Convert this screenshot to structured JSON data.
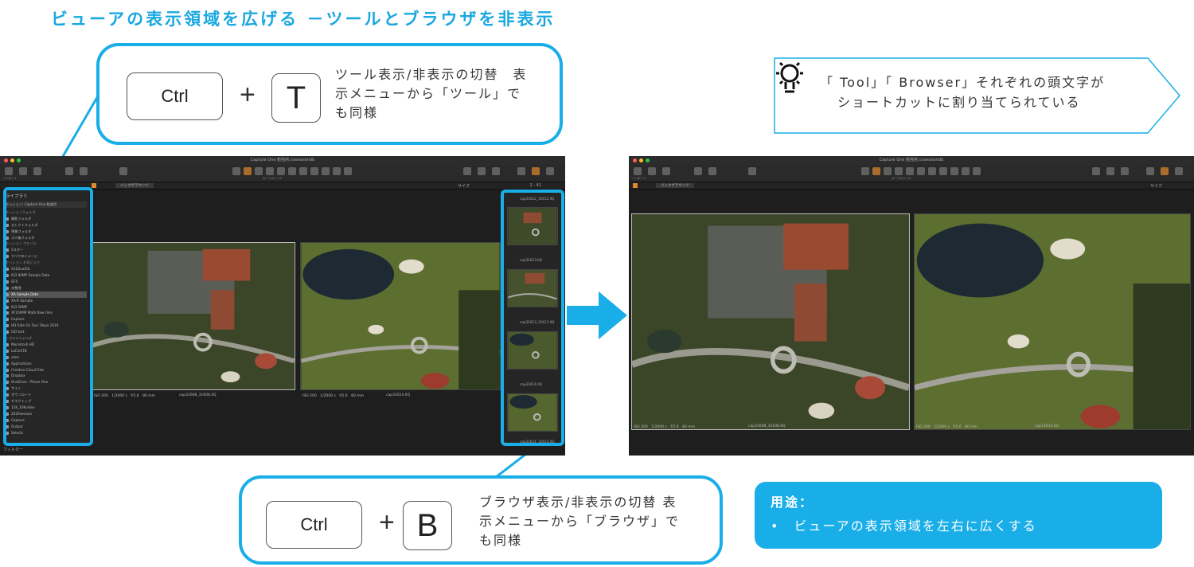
{
  "page": {
    "title": "ビューアの表示領域を広げる －ツールとブラウザを非表示"
  },
  "shortcut_tools": {
    "modifier": "Ctrl",
    "plus": "+",
    "key": "T",
    "desc_line1": "ツール表示/非表示の切替　表",
    "desc_line2": "示メニューから「ツール」で",
    "desc_line3": "も同様"
  },
  "shortcut_browser": {
    "modifier": "Ctrl",
    "plus": "+",
    "key": "B",
    "desc_line1": "ブラウザ表示/非表示の切替 表",
    "desc_line2": "示メニューから「ブラウザ」で",
    "desc_line3": "も同様"
  },
  "tip": {
    "icon": "lightbulb-icon",
    "line1": "「 Tool」「 Browser」それぞれの頭文字が",
    "line2": "ショートカットに割り当てられている"
  },
  "use": {
    "title": "用途：",
    "item": "•　ビューアの表示領域を左右に広くする"
  },
  "app": {
    "window_title": "Capture One 勉強用.cosessiondb",
    "toolbar_left": [
      "インポート",
      "エクスポート",
      "撮影"
    ],
    "toolbar_undo": [
      "リセット",
      "取り消す/やり直す"
    ],
    "toolbar_auto": "オート調整",
    "toolbar_cursor": "カーソルツール",
    "toolbar_right": [
      "ビフォー",
      "グリッド",
      "露出警告",
      "予定",
      "選択項目を編集",
      "コピー/適用"
    ],
    "background_select": "バックグラウンド",
    "size_label": "サイズ",
    "count": "2 - 41",
    "library": {
      "title": "ライブラリ",
      "session_select": "セッション: Capture One 勉強用",
      "rows": [
        {
          "label": "セッションフォルダ",
          "type": "hd"
        },
        {
          "label": "撮影フォルダ",
          "type": "item"
        },
        {
          "label": "セレクトフォルダ",
          "type": "item"
        },
        {
          "label": "現像フォルダ",
          "type": "item"
        },
        {
          "label": "ゴミ箱フォルダ",
          "type": "item"
        },
        {
          "label": "セッション アルバム",
          "type": "hd"
        },
        {
          "label": "5スター",
          "type": "item"
        },
        {
          "label": "すべてのイメージ",
          "type": "item"
        },
        {
          "label": "セッション お気に入り",
          "type": "hd"
        },
        {
          "label": "X1D2ux50c",
          "type": "item"
        },
        {
          "label": "IQ3 80MP Sample Data",
          "type": "item"
        },
        {
          "label": "GFX",
          "type": "item"
        },
        {
          "label": "未整理",
          "type": "item"
        },
        {
          "label": "XA Sample Data",
          "type": "sel"
        },
        {
          "label": "XA-R Sample",
          "type": "item"
        },
        {
          "label": "IQ3 50MP",
          "type": "item"
        },
        {
          "label": "XF100MP Math Raw Files",
          "type": "item"
        },
        {
          "label": "Capture",
          "type": "item"
        },
        {
          "label": "HD Ride On Tour Tokyo 2019",
          "type": "item"
        },
        {
          "label": "ISO test",
          "type": "item"
        },
        {
          "label": "システムフォルダ",
          "type": "hd"
        },
        {
          "label": "Macintosh HD",
          "type": "item"
        },
        {
          "label": "LaCie1TB",
          "type": "item"
        },
        {
          "label": "alien",
          "type": "item"
        },
        {
          "label": "Applications",
          "type": "item"
        },
        {
          "label": "Creative Cloud Files",
          "type": "item"
        },
        {
          "label": "Dropbox",
          "type": "item"
        },
        {
          "label": "OneDrive - Phase One",
          "type": "item"
        },
        {
          "label": "サイト",
          "type": "item"
        },
        {
          "label": "ダウンロード",
          "type": "item"
        },
        {
          "label": "デスクトップ",
          "type": "item"
        },
        {
          "label": "12K_10Kvideo",
          "type": "item"
        },
        {
          "label": "2020session",
          "type": "item"
        },
        {
          "label": "Capture",
          "type": "item"
        },
        {
          "label": "Output",
          "type": "item"
        },
        {
          "label": "Selects",
          "type": "item"
        }
      ],
      "filter_label": "フィルター"
    },
    "viewer_images": [
      {
        "meta": "ISO 200　1/2000 s　f/5.6　80 mm",
        "name": "cap31608_31608.IIQ"
      },
      {
        "meta": "ISO 200　1/2000 s　f/5.6　80 mm",
        "name": "cap31614.IIQ"
      }
    ],
    "thumbnails": [
      {
        "name": "cap31612_31612.IIQ"
      },
      {
        "name": "cap31613.IIQ"
      },
      {
        "name": "cap31613_31613.IIQ"
      },
      {
        "name": "cap31614.IIQ"
      },
      {
        "name": "cap31614_31614.IIQ"
      }
    ]
  },
  "colors": {
    "accent": "#19aee8",
    "title": "#19a8e0",
    "window_bg": "#1e1e1e"
  }
}
